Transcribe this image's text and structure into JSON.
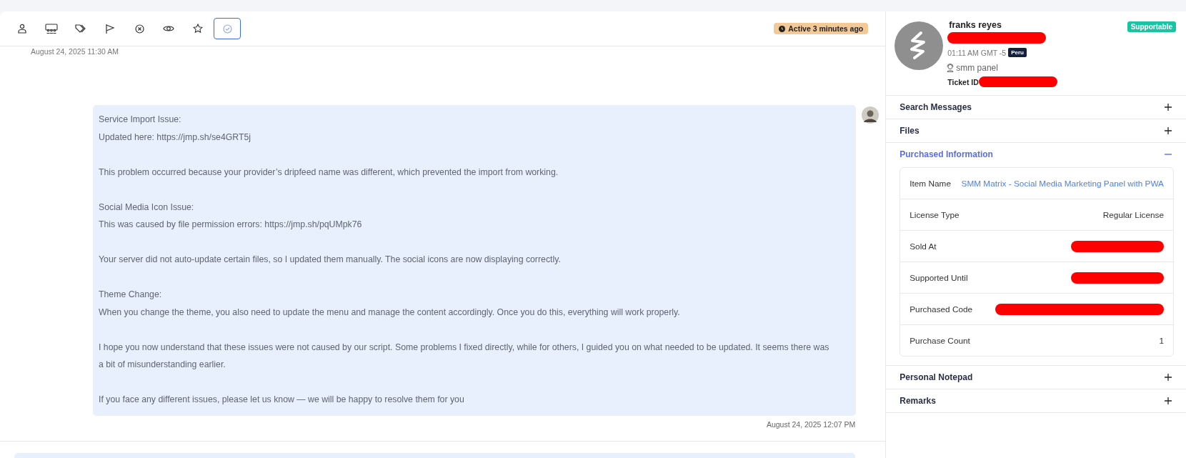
{
  "toolbar": [
    {
      "kind": "user",
      "selected": false
    },
    {
      "kind": "group",
      "selected": false
    },
    {
      "kind": "tags",
      "selected": false
    },
    {
      "kind": "flag",
      "selected": false
    },
    {
      "kind": "close",
      "selected": false
    },
    {
      "kind": "eye",
      "selected": false
    },
    {
      "kind": "star",
      "selected": false
    },
    {
      "kind": "check",
      "selected": true
    }
  ],
  "status_badge": "Active 3 minutes ago",
  "previous_message_time": "August 24, 2025 11:30 AM",
  "message": {
    "paragraphs": [
      [
        "Service Import Issue:",
        "Updated here: https://jmp.sh/se4GRT5j"
      ],
      [
        "This problem occurred because your provider’s dripfeed name was different, which prevented the import from working."
      ],
      [
        "Social Media Icon Issue:",
        "This was caused by file permission errors: https://jmp.sh/pqUMpk76"
      ],
      [
        "Your server did not auto-update certain files, so I updated them manually. The social icons are now displaying correctly."
      ],
      [
        "Theme Change:",
        "When you change the theme, you also need to update the menu and manage the content accordingly. Once you do this, everything will work properly."
      ],
      [
        "I hope you now understand that these issues were not caused by our script. Some problems I fixed directly, while for others, I guided you on what needed to be updated. It seems there was a bit of misunderstanding earlier."
      ],
      [
        "If you face any different issues, please let us know — we will be happy to resolve them for you"
      ]
    ],
    "time": "August 24, 2025 12:07 PM"
  },
  "customer": {
    "name": "franks reyes",
    "contact_redacted": true,
    "local_time": "01:11 AM GMT -5",
    "country": "Peru",
    "product": "smm panel",
    "ticket_label": "Ticket ID",
    "ticket_redacted": true,
    "badge": "Supportable"
  },
  "sections": [
    {
      "title": "Search Messages",
      "expanded": false
    },
    {
      "title": "Files",
      "expanded": false
    },
    {
      "title": "Purchased Information",
      "expanded": true,
      "rows": [
        {
          "label": "Item Name",
          "value": "SMM Matrix - Social Media Marketing Panel with PWA",
          "link": true
        },
        {
          "label": "License Type",
          "value": "Regular License"
        },
        {
          "label": "Sold At",
          "redacted": true
        },
        {
          "label": "Supported Until",
          "redacted": true
        },
        {
          "label": "Purchased Code",
          "redacted": true,
          "wide": true
        },
        {
          "label": "Purchase Count",
          "value": "1"
        }
      ]
    },
    {
      "title": "Personal Notepad",
      "expanded": false
    },
    {
      "title": "Remarks",
      "expanded": false
    }
  ]
}
